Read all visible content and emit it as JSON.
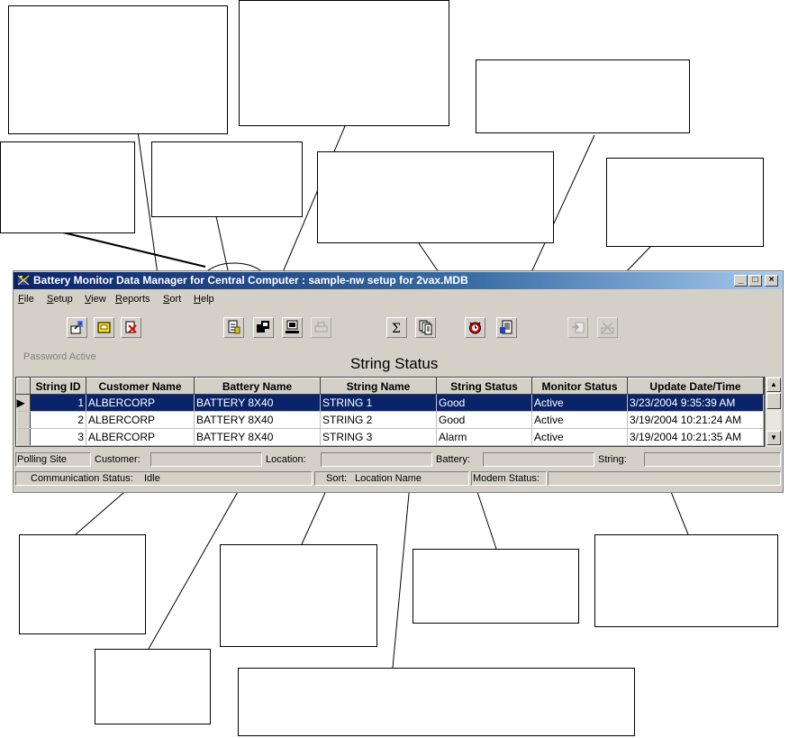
{
  "window": {
    "title": "Battery Monitor Data Manager for Central Computer :  sample-nw setup for 2vax.MDB",
    "min_btn": "_",
    "max_btn": "□",
    "close_btn": "×"
  },
  "menu": [
    "File",
    "Setup",
    "View",
    "Reports",
    "Sort",
    "Help"
  ],
  "toolbar_icons": [
    "export-icon",
    "open-icon",
    "delete-icon",
    "import-icon",
    "sync-icon",
    "monitor-icon",
    "print-icon",
    "summary-icon",
    "copy-icon",
    "alarm-icon",
    "report-icon",
    "add-icon",
    "dialup-icon"
  ],
  "password_status": "Password Active",
  "grid": {
    "title": "String Status",
    "columns": [
      "String ID",
      "Customer Name",
      "Battery Name",
      "String Name",
      "String Status",
      "Monitor Status",
      "Update Date/Time"
    ],
    "rows": [
      [
        "1",
        "ALBERCORP",
        "BATTERY 8X40",
        "STRING 1",
        "Good",
        "Active",
        "3/23/2004 9:35:39 AM"
      ],
      [
        "2",
        "ALBERCORP",
        "BATTERY 8X40",
        "STRING 2",
        "Good",
        "Active",
        "3/19/2004 10:21:24 AM"
      ],
      [
        "3",
        "ALBERCORP",
        "BATTERY 8X40",
        "STRING 3",
        "Alarm",
        "Active",
        "3/19/2004 10:21:35 AM"
      ]
    ],
    "selected_row": 0,
    "row_indicator": "▶",
    "scroll_up": "▲",
    "scroll_down": "▼"
  },
  "status_bar": {
    "polling_site": "Polling Site",
    "customer_label": "Customer:",
    "location_label": "Location:",
    "battery_label": "Battery:",
    "string_label": "String:",
    "comm_status_label": "Communication Status:",
    "comm_status_value": "Idle",
    "sort_label": "Sort:",
    "sort_value": "Location Name",
    "modem_status_label": "Modem Status:"
  }
}
